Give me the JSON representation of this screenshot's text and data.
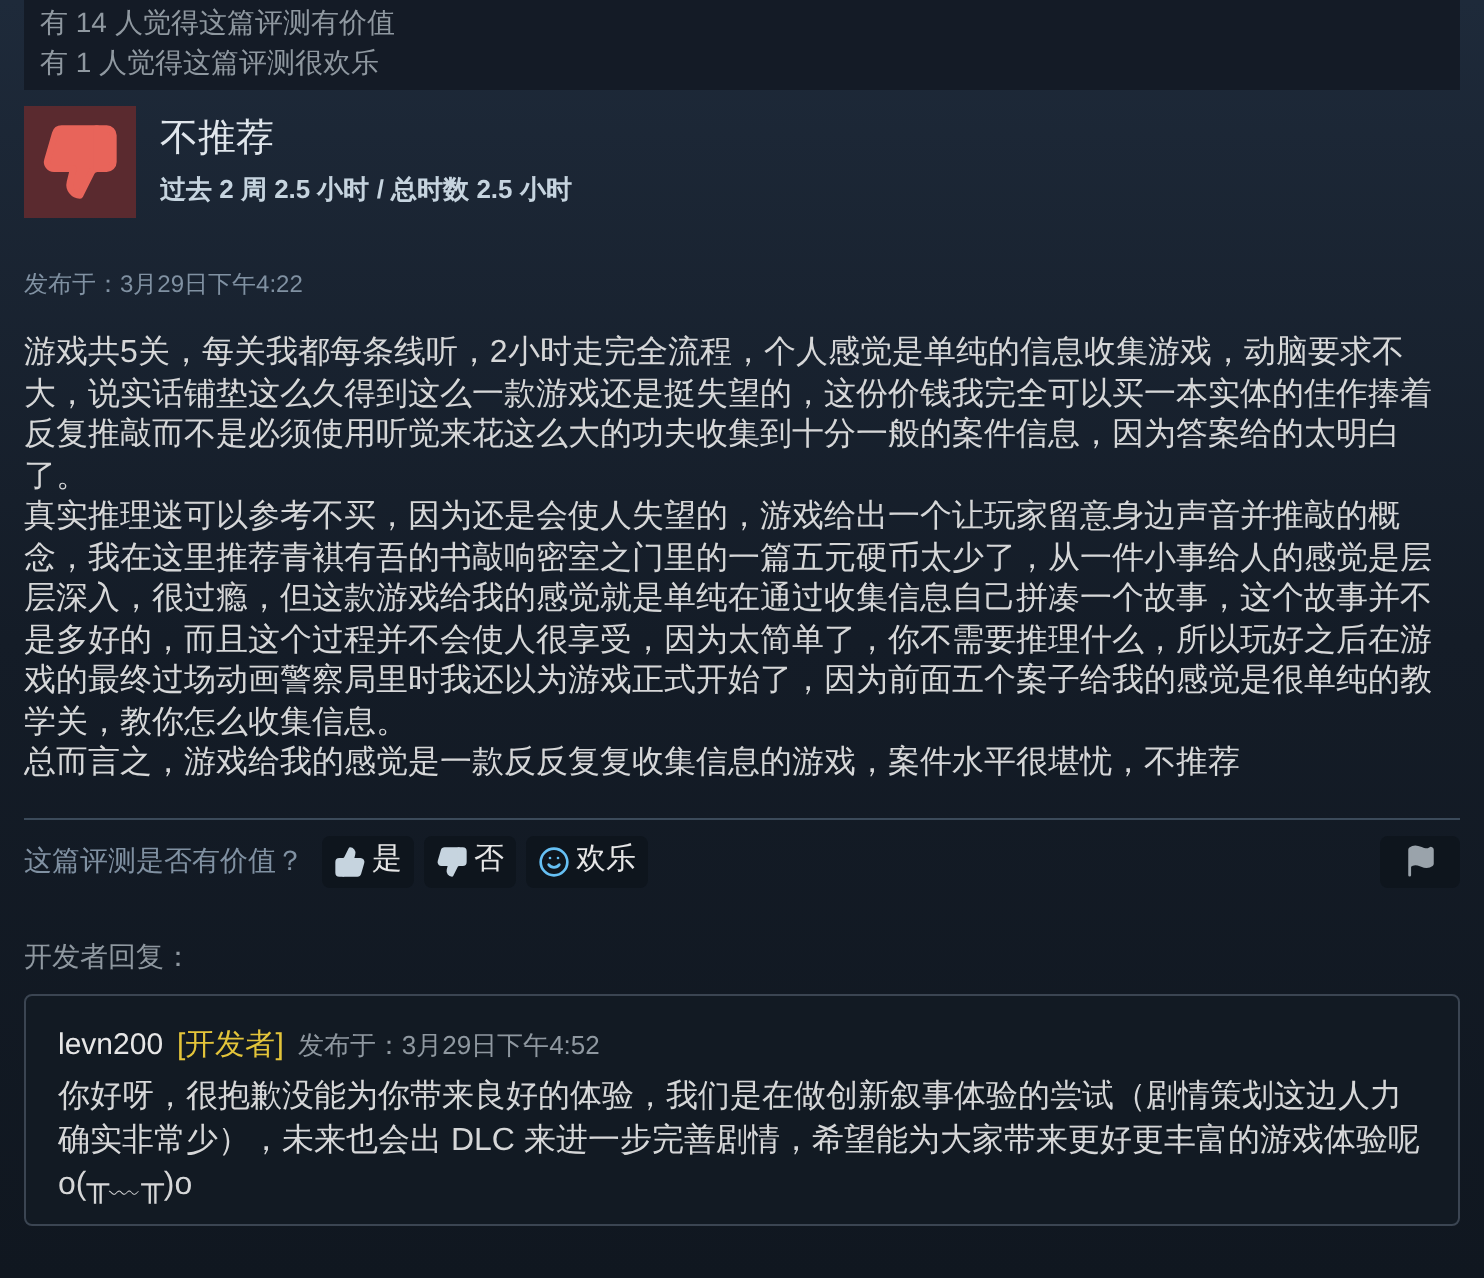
{
  "stats": [
    "有 14 人觉得这篇评测有价值",
    "有 1 人觉得这篇评测很欢乐"
  ],
  "review": {
    "verdict": "不推荐",
    "kind": "negative",
    "hours": "过去 2 周 2.5 小时 / 总时数 2.5 小时",
    "posted": "发布于：3月29日下午4:22",
    "paragraphs": [
      "游戏共5关，每关我都每条线听，2小时走完全流程，个人感觉是单纯的信息收集游戏，动脑要求不大，说实话铺垫这么久得到这么一款游戏还是挺失望的，这份价钱我完全可以买一本实体的佳作捧着反复推敲而不是必须使用听觉来花这么大的功夫收集到十分一般的案件信息，因为答案给的太明白了。",
      "真实推理迷可以参考不买，因为还是会使人失望的，游戏给出一个让玩家留意身边声音并推敲的概念，我在这里推荐青褀有吾的书敲响密室之门里的一篇五元硬币太少了，从一件小事给人的感觉是层层深入，很过瘾，但这款游戏给我的感觉就是单纯在通过收集信息自己拼凑一个故事，这个故事并不是多好的，而且这个过程并不会使人很享受，因为太简单了，你不需要推理什么，所以玩好之后在游戏的最终过场动画警察局里时我还以为游戏正式开始了，因为前面五个案子给我的感觉是很单纯的教学关，教你怎么收集信息。",
      "总而言之，游戏给我的感觉是一款反反复复收集信息的游戏，案件水平很堪忧，不推荐"
    ]
  },
  "feedback": {
    "question": "这篇评测是否有价值？",
    "buttons": [
      {
        "kind": "yes",
        "label": "是"
      },
      {
        "kind": "no",
        "label": "否"
      },
      {
        "kind": "funny",
        "label": "欢乐"
      }
    ]
  },
  "developer_response": {
    "heading": "开发者回复：",
    "author": "levn200",
    "badge": "[开发者]",
    "posted": "发布于：3月29日下午4:52",
    "text": "你好呀，很抱歉没能为你带来良好的体验，我们是在做创新叙事体验的尝试（剧情策划这边人力确实非常少），未来也会出 DLC 来进一步完善剧情，希望能为大家带来更好更丰富的游戏体验呢o(╥﹏╥)o"
  }
}
